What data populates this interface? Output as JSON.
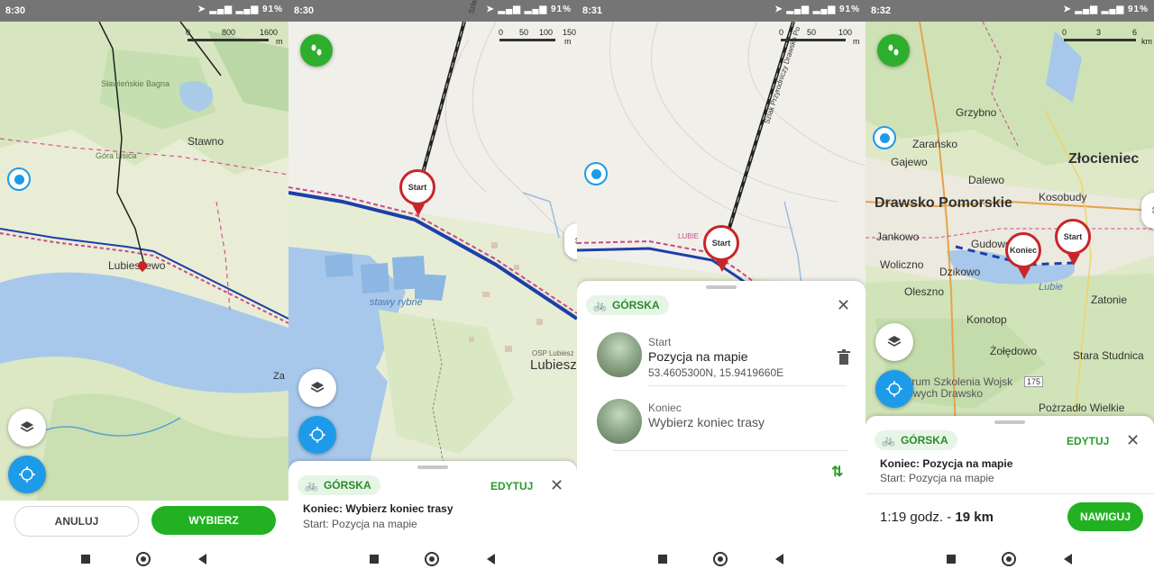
{
  "screens": [
    {
      "status": {
        "time": "8:30",
        "battery": "91%"
      },
      "scale": {
        "labels": [
          "0",
          "800",
          "1600"
        ],
        "unit": "m"
      },
      "map_labels": [
        "Sławieńskie Bagna",
        "Stawno",
        "Góra Lisica",
        "Lubieszewo",
        "Za"
      ],
      "buttons": {
        "cancel": "ANULUJ",
        "select": "WYBIERZ"
      }
    },
    {
      "status": {
        "time": "8:30",
        "battery": "91%"
      },
      "scale": {
        "labels": [
          "0",
          "50",
          "100",
          "150"
        ],
        "unit": "m"
      },
      "map_labels": [
        "Szlak Przyrodniczy Drawsk",
        "stawy rybne",
        "OSP Lubiesz",
        "Lubiesz",
        "Start"
      ],
      "sheet": {
        "profile": "GÓRSKA",
        "edit": "EDYTUJ",
        "close": "✕",
        "title": "Koniec: Wybierz koniec trasy",
        "subtitle": "Start: Pozycja na mapie"
      }
    },
    {
      "status": {
        "time": "8:31",
        "battery": "91%"
      },
      "scale": {
        "labels": [
          "0",
          "50",
          "100"
        ],
        "unit": "m"
      },
      "map_labels": [
        "Szlak Przyrodniczy Drawsko Po",
        "LUBIE",
        "Start"
      ],
      "sheet": {
        "profile": "GÓRSKA",
        "close": "✕",
        "start_label": "Start",
        "start_title": "Pozycja na mapie",
        "start_coords": "53.4605300N, 15.9419660E",
        "end_label": "Koniec",
        "end_title": "Wybierz koniec trasy"
      }
    },
    {
      "status": {
        "time": "8:32",
        "battery": "91%"
      },
      "scale": {
        "labels": [
          "0",
          "3",
          "6"
        ],
        "unit": "km"
      },
      "map_labels": [
        "Grzybno",
        "Zarańsko",
        "Gajewo",
        "Dalewo",
        "Złocieniec",
        "Kosobudy",
        "Drawsko Pomorskie",
        "Jankowo",
        "Gudowo",
        "Woliczno",
        "Dzikowo",
        "Oleszno",
        "Lubie",
        "Zatonie",
        "Konotop",
        "Żołędowo",
        "Stara Studnica",
        "Centrum Szkolenia Wojsk Lądowych Drawsko",
        "Pożrzadło Wielkie",
        "Koniec",
        "Start",
        "175"
      ],
      "sheet": {
        "profile": "GÓRSKA",
        "edit": "EDYTUJ",
        "close": "✕",
        "title": "Koniec: Pozycja na mapie",
        "subtitle": "Start: Pozycja na mapie",
        "duration": "1:19 godz. - ",
        "distance": "19 km",
        "navigate": "NAWIGUJ"
      }
    }
  ],
  "colors": {
    "accent_green": "#22b122",
    "pin_red": "#c8252b",
    "route_blue": "#1c3fa8",
    "location_blue": "#1e9be8"
  }
}
